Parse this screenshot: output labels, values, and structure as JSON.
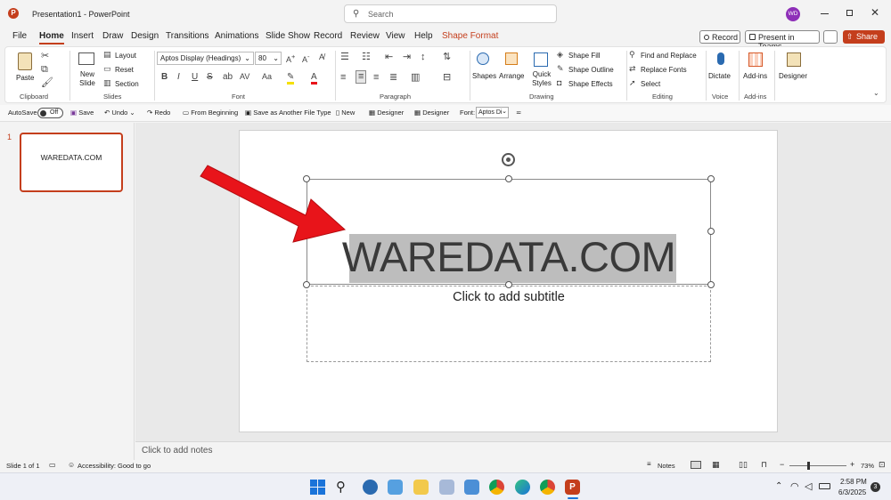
{
  "titlebar": {
    "app_title": "Presentation1 - PowerPoint",
    "search_placeholder": "Search",
    "avatar_initials": "WD"
  },
  "menu": {
    "tabs": [
      "File",
      "Home",
      "Insert",
      "Draw",
      "Design",
      "Transitions",
      "Animations",
      "Slide Show",
      "Record",
      "Review",
      "View",
      "Help",
      "Shape Format"
    ],
    "record_button": "Record",
    "present_teams_button": "Present in Teams",
    "share_button": "Share"
  },
  "ribbon": {
    "clipboard": {
      "paste": "Paste",
      "group": "Clipboard"
    },
    "slides": {
      "new_slide": "New Slide",
      "layout": "Layout",
      "reset": "Reset",
      "section": "Section",
      "group": "Slides"
    },
    "font": {
      "font_name": "Aptos Display (Headings)",
      "font_size": "80",
      "group": "Font"
    },
    "paragraph": {
      "group": "Paragraph"
    },
    "drawing": {
      "shapes": "Shapes",
      "arrange": "Arrange",
      "quick_styles": "Quick Styles",
      "shape_fill": "Shape Fill",
      "shape_outline": "Shape Outline",
      "shape_effects": "Shape Effects",
      "group": "Drawing"
    },
    "editing": {
      "find_replace": "Find and Replace",
      "replace_fonts": "Replace Fonts",
      "select": "Select",
      "group": "Editing"
    },
    "voice": {
      "dictate": "Dictate",
      "group": "Voice"
    },
    "addins": {
      "addins": "Add-ins",
      "group": "Add-ins"
    },
    "designer": {
      "designer": "Designer"
    }
  },
  "qat": {
    "autosave": "AutoSave",
    "autosave_state": "Off",
    "save": "Save",
    "undo": "Undo",
    "redo": "Redo",
    "from_beginning": "From Beginning",
    "save_as": "Save as Another File Type",
    "new": "New",
    "designer1": "Designer",
    "designer2": "Designer",
    "font_label": "Font:",
    "font_value": "Aptos Di"
  },
  "thumbnails": [
    {
      "number": "1",
      "text": "WAREDATA.COM"
    }
  ],
  "slide": {
    "title": "WAREDATA.COM",
    "subtitle_placeholder": "Click to add subtitle"
  },
  "notes_placeholder": "Click to add notes",
  "status": {
    "slide_counter": "Slide 1 of 1",
    "accessibility": "Accessibility: Good to go",
    "notes": "Notes",
    "zoom": "73%"
  },
  "taskbar": {
    "time": "2:58 PM",
    "date": "6/3/2025",
    "notification_count": "3"
  },
  "colors": {
    "accent": "#c43e1c",
    "arrow": "#e8141a",
    "selection_highlight": "#bdbdbd",
    "avatar": "#8e2fb8"
  }
}
